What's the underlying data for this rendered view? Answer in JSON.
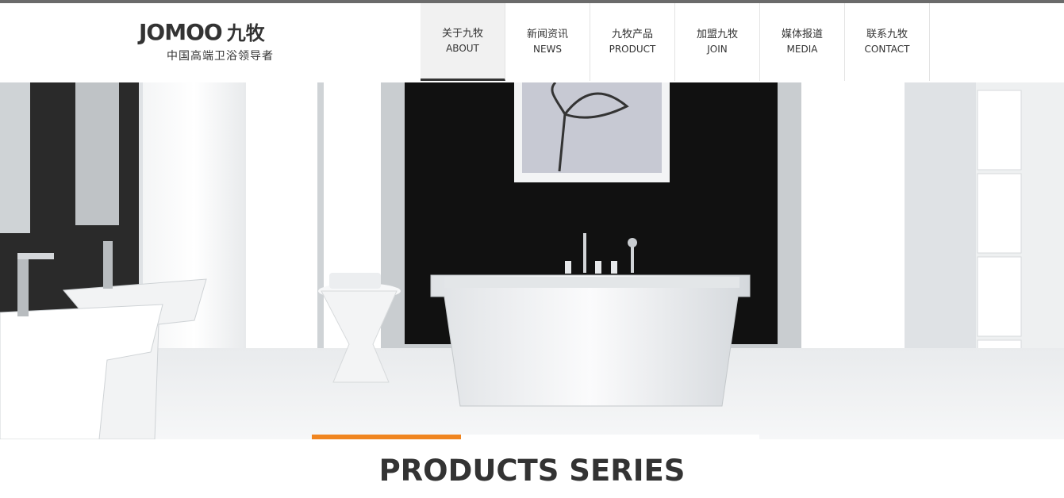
{
  "brand": {
    "logo_text": "JOMOO",
    "logo_cn": "九牧",
    "slogan": "中国高端卫浴领导者"
  },
  "nav": {
    "items": [
      {
        "cn": "关于九牧",
        "en": "ABOUT",
        "active": true
      },
      {
        "cn": "新闻资讯",
        "en": "NEWS",
        "active": false
      },
      {
        "cn": "九牧产品",
        "en": "PRODUCT",
        "active": false
      },
      {
        "cn": "加盟九牧",
        "en": "JOIN",
        "active": false
      },
      {
        "cn": "媒体报道",
        "en": "MEDIA",
        "active": false
      },
      {
        "cn": "联系九牧",
        "en": "CONTACT",
        "active": false
      }
    ]
  },
  "banner": {
    "slide_progress": 0.333
  },
  "section": {
    "title": "PRODUCTS SERIES"
  },
  "colors": {
    "accent": "#f08520",
    "text": "#333333"
  }
}
